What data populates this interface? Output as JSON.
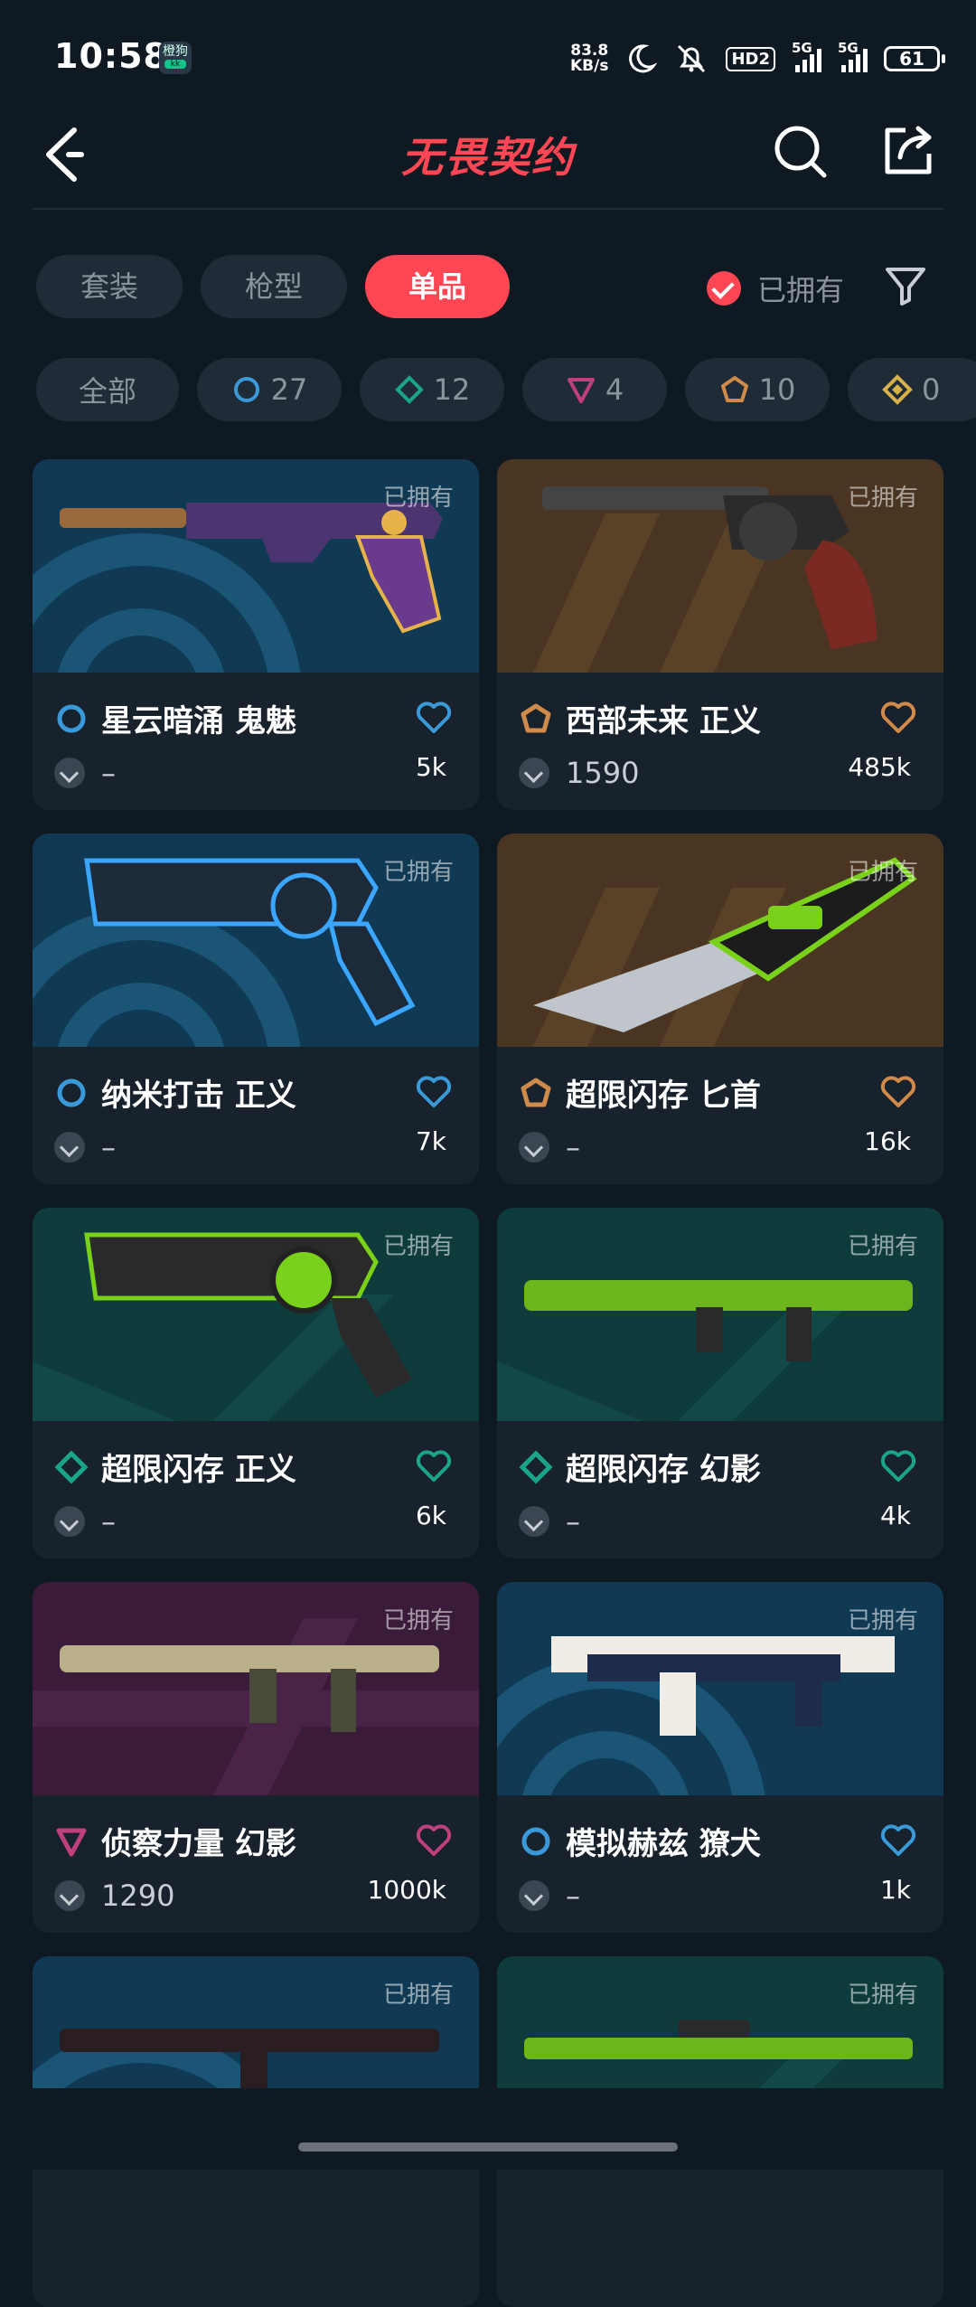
{
  "status_bar": {
    "time": "10:58",
    "app_badge_top": "橙狗",
    "app_badge_bottom": "kk",
    "net_speed": "83.8",
    "net_unit": "KB/s",
    "hd": "HD2",
    "sig1": "5G",
    "sig2": "5G",
    "battery": "61"
  },
  "header": {
    "title": "无畏契约",
    "back_icon": "back-arrow-icon",
    "search_icon": "search-icon",
    "share_icon": "share-icon"
  },
  "tabs": [
    {
      "label": "套装",
      "active": false
    },
    {
      "label": "枪型",
      "active": false
    },
    {
      "label": "单品",
      "active": true
    }
  ],
  "owned_filter": {
    "label": "已拥有",
    "checked": true
  },
  "filter_icon": "filter-funnel-icon",
  "tier_chips": [
    {
      "label": "全部",
      "icon": null
    },
    {
      "label": "27",
      "icon": "select-tier-icon",
      "color": "#3a9ad9"
    },
    {
      "label": "12",
      "icon": "deluxe-tier-icon",
      "color": "#1aa58a"
    },
    {
      "label": "4",
      "icon": "premium-tier-icon",
      "color": "#c0407e"
    },
    {
      "label": "10",
      "icon": "exclusive-tier-icon",
      "color": "#d08a4a"
    },
    {
      "label": "0",
      "icon": "ultra-tier-icon",
      "color": "#d6b24a"
    }
  ],
  "owned_tag": "已拥有",
  "cards": [
    {
      "name": "星云暗涌 鬼魅",
      "tier": "select",
      "tier_color": "#3a9ad9",
      "price": "–",
      "likes": "5k"
    },
    {
      "name": "西部未来 正义",
      "tier": "exclusive",
      "tier_color": "#d08a4a",
      "price": "1590",
      "likes": "485k"
    },
    {
      "name": "纳米打击 正义",
      "tier": "select",
      "tier_color": "#3a9ad9",
      "price": "–",
      "likes": "7k"
    },
    {
      "name": "超限闪存 匕首",
      "tier": "exclusive",
      "tier_color": "#d08a4a",
      "price": "–",
      "likes": "16k"
    },
    {
      "name": "超限闪存 正义",
      "tier": "deluxe",
      "tier_color": "#1aa58a",
      "price": "–",
      "likes": "6k"
    },
    {
      "name": "超限闪存 幻影",
      "tier": "deluxe",
      "tier_color": "#1aa58a",
      "price": "–",
      "likes": "4k"
    },
    {
      "name": "侦察力量 幻影",
      "tier": "premium",
      "tier_color": "#c0407e",
      "price": "1290",
      "likes": "1000k"
    },
    {
      "name": "模拟赫兹 獠犬",
      "tier": "select",
      "tier_color": "#3a9ad9",
      "price": "–",
      "likes": "1k"
    },
    {
      "name": "",
      "tier": "select",
      "tier_color": "#3a9ad9",
      "price": "",
      "likes": ""
    },
    {
      "name": "",
      "tier": "deluxe",
      "tier_color": "#1aa58a",
      "price": "",
      "likes": ""
    }
  ]
}
